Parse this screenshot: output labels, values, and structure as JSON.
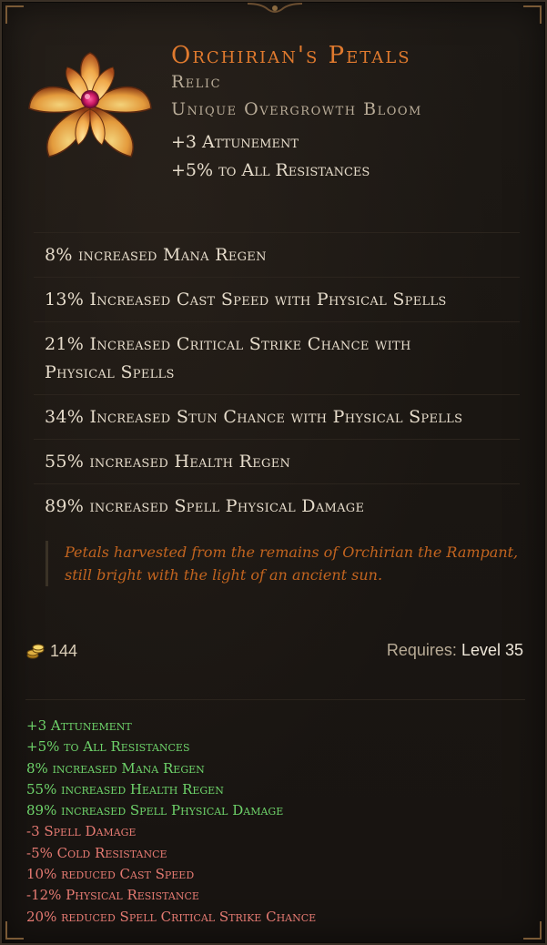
{
  "item": {
    "name": "Orchirian's Petals",
    "type": "Relic",
    "subtype": "Unique Overgrowth Bloom",
    "implicits": [
      "+3 Attunement",
      "+5% to All Resistances"
    ],
    "affixes": [
      {
        "text": "8% increased Mana Regen"
      },
      {
        "text": "13% Increased Cast Speed with Physical Spells"
      },
      {
        "text": "21% Increased Critical Strike Chance with Physical Spells"
      },
      {
        "text": "34% Increased Stun Chance with Physical Spells"
      },
      {
        "text": "55% increased Health Regen"
      },
      {
        "text": "89% increased Spell Physical Damage"
      }
    ],
    "lore": "Petals harvested from the remains of Orchirian the Rampant, still bright with the light of an ancient sun.",
    "gold": "144",
    "requires_label": "Requires:",
    "requires_value": "Level 35",
    "icon": "flower-relic-icon"
  },
  "comparison": [
    {
      "text": "+3 Attunement",
      "kind": "positive"
    },
    {
      "text": "+5% to All Resistances",
      "kind": "positive"
    },
    {
      "text": "8% increased Mana Regen",
      "kind": "positive"
    },
    {
      "text": "55% increased Health Regen",
      "kind": "positive"
    },
    {
      "text": "89% increased Spell Physical Damage",
      "kind": "positive"
    },
    {
      "text": "-3 Spell Damage",
      "kind": "negative"
    },
    {
      "text": "-5% Cold Resistance",
      "kind": "negative"
    },
    {
      "text": "10% reduced Cast Speed",
      "kind": "negative"
    },
    {
      "text": "-12% Physical Resistance",
      "kind": "negative"
    },
    {
      "text": "20% reduced Spell Critical Strike Chance",
      "kind": "negative"
    }
  ],
  "colors": {
    "unique_name": "#e07a2e",
    "positive": "#6ed36a",
    "negative": "#e57a72",
    "lore": "#c2641f"
  }
}
